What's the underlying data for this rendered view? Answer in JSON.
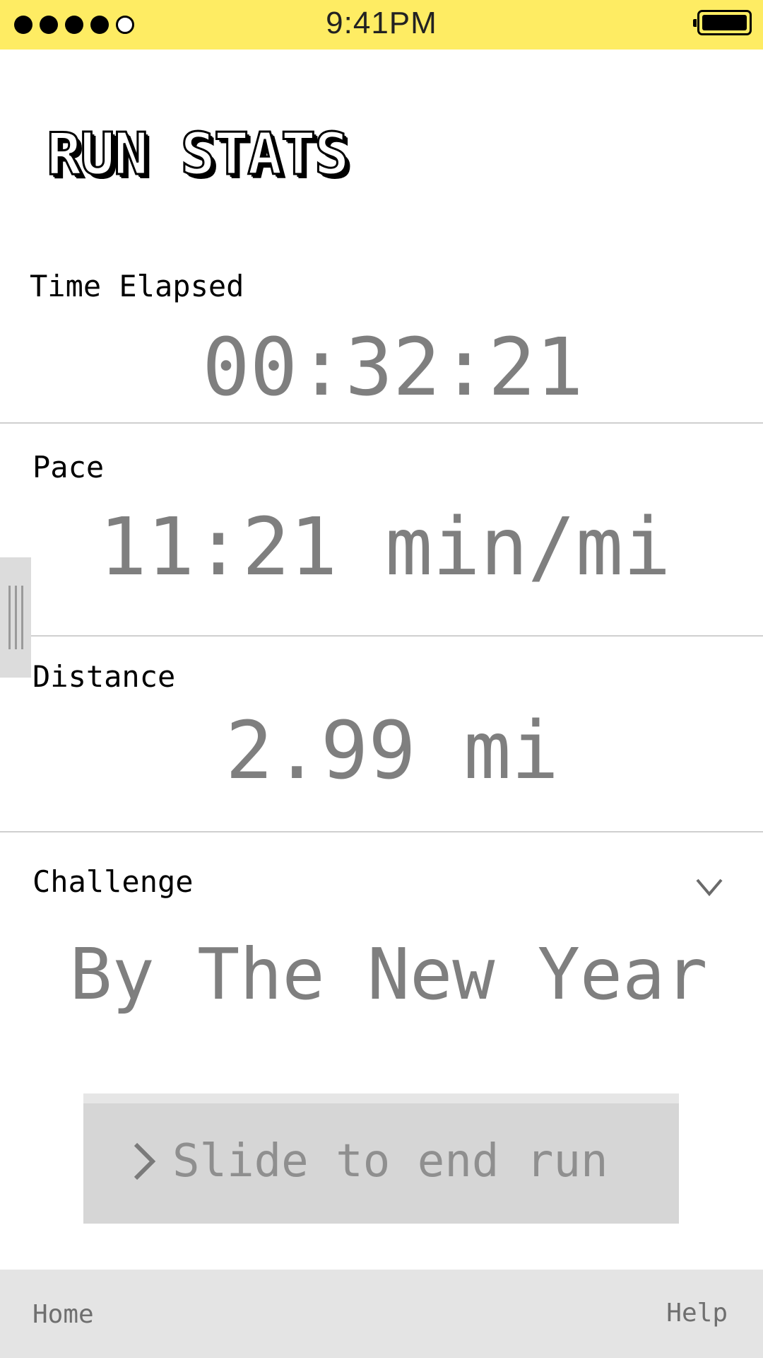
{
  "status_bar": {
    "time": "9:41PM",
    "signal_icon": "signal-dots-icon",
    "battery_icon": "battery-full-icon"
  },
  "app": {
    "title": "RUN STATS"
  },
  "stats": {
    "time_elapsed": {
      "label": "Time Elapsed",
      "value": "00:32:21"
    },
    "pace": {
      "label": "Pace",
      "value": "11:21 min/mi"
    },
    "distance": {
      "label": "Distance",
      "value": "2.99 mi"
    },
    "challenge": {
      "label": "Challenge",
      "value": "By The New Year",
      "toggle_icon": "chevron-down-icon"
    }
  },
  "slider": {
    "label": "Slide to end run",
    "icon": "chevron-right-icon"
  },
  "side_panel": {
    "icon": "drag-handle-icon"
  },
  "bottom_nav": {
    "home_label": "Home",
    "help_label": "Help"
  },
  "colors": {
    "status_bar_bg": "#feec63",
    "value_text": "#7f7f7f",
    "slider_bg": "#d6d6d6",
    "nav_bg": "#e4e4e4"
  }
}
